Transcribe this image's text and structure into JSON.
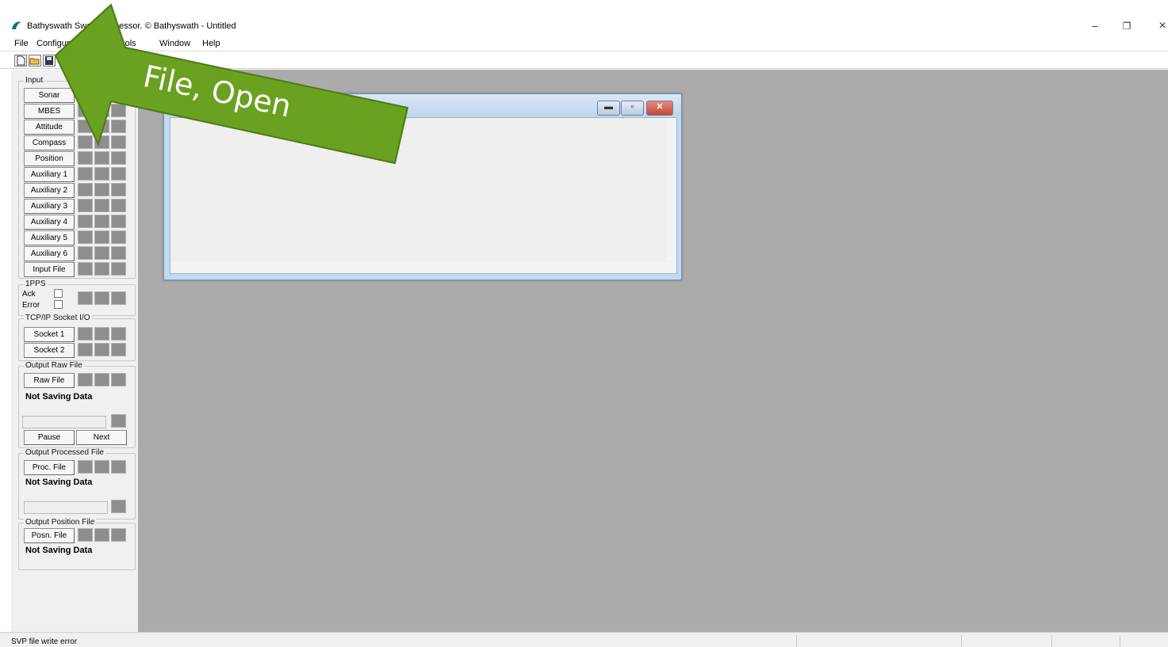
{
  "window": {
    "title": "Bathyswath Swath Processor. © Bathyswath - Untitled",
    "controls": {
      "minimize": "−",
      "restore": "❐",
      "close": "×"
    }
  },
  "menu": [
    "File",
    "Configure",
    "Tools",
    "Window",
    "Help"
  ],
  "toolbar": {
    "icons": [
      "new-file-icon",
      "open-folder-icon",
      "save-icon"
    ]
  },
  "panel": {
    "input": {
      "label": "Input",
      "buttons": [
        "Sonar",
        "MBES",
        "Attitude",
        "Compass",
        "Position",
        "Auxiliary 1",
        "Auxiliary 2",
        "Auxiliary 3",
        "Auxiliary 4",
        "Auxiliary 5",
        "Auxiliary 6",
        "Input File"
      ]
    },
    "pps": {
      "label": "1PPS",
      "ack": "Ack",
      "error": "Error"
    },
    "tcp": {
      "label": "TCP/IP Socket I/O",
      "buttons": [
        "Socket 1",
        "Socket 2"
      ]
    },
    "raw": {
      "label": "Output Raw File",
      "button": "Raw File",
      "status": "Not Saving Data",
      "pause": "Pause",
      "next": "Next"
    },
    "processed": {
      "label": "Output Processed File",
      "button": "Proc. File",
      "status": "Not Saving Data"
    },
    "position": {
      "label": "Output Position File",
      "button": "Posn. File",
      "status": "Not Saving Data"
    }
  },
  "status_bar": {
    "text": "SVP file write error"
  },
  "annotation": {
    "text": "File, Open",
    "color": "#6aa121"
  },
  "colors": {
    "workspace": "#ababab",
    "indicator": "#8e8e8e",
    "arrow": "#6aa121",
    "close_button": "#c94437"
  }
}
